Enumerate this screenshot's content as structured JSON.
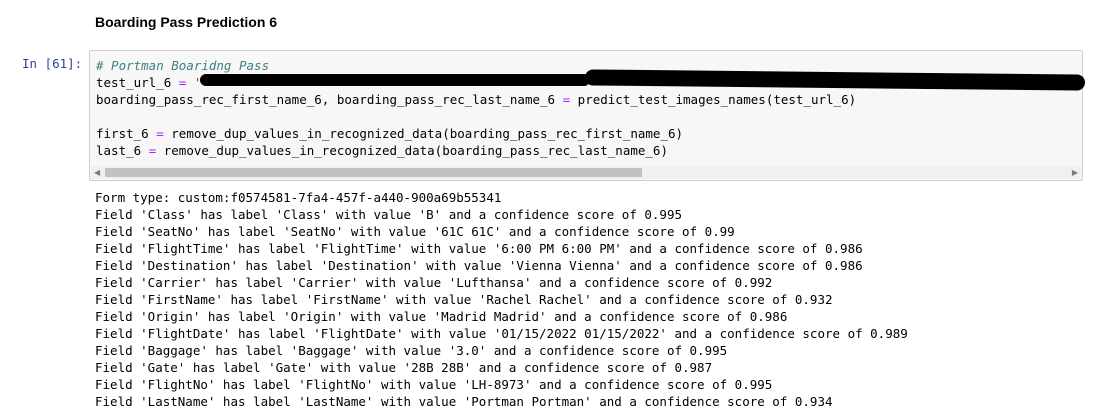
{
  "markdown": {
    "heading": "Boarding Pass Prediction 6"
  },
  "cell": {
    "prompt": "In [61]:",
    "comment": "# Portman Boaridng Pass",
    "line2_var": "test_url_6",
    "line2_eq": "=",
    "line2_quote": "'",
    "line3_lhs": "boarding_pass_rec_first_name_6, boarding_pass_rec_last_name_6",
    "line3_eq": "=",
    "line3_rhs": "predict_test_images_names(test_url_6)",
    "line5_lhs": "first_6",
    "line5_eq": "=",
    "line5_rhs": "remove_dup_values_in_recognized_data(boarding_pass_rec_first_name_6)",
    "line6_lhs": "last_6",
    "line6_eq": "=",
    "line6_rhs": "remove_dup_values_in_recognized_data(boarding_pass_rec_last_name_6)"
  },
  "scrollbar": {
    "left_arrow": "◀",
    "right_arrow": "▶"
  },
  "output": {
    "lines": [
      "Form type: custom:f0574581-7fa4-457f-a440-900a69b55341",
      "Field 'Class' has label 'Class' with value 'B' and a confidence score of 0.995",
      "Field 'SeatNo' has label 'SeatNo' with value '61C 61C' and a confidence score of 0.99",
      "Field 'FlightTime' has label 'FlightTime' with value '6:00 PM 6:00 PM' and a confidence score of 0.986",
      "Field 'Destination' has label 'Destination' with value 'Vienna Vienna' and a confidence score of 0.986",
      "Field 'Carrier' has label 'Carrier' with value 'Lufthansa' and a confidence score of 0.992",
      "Field 'FirstName' has label 'FirstName' with value 'Rachel Rachel' and a confidence score of 0.932",
      "Field 'Origin' has label 'Origin' with value 'Madrid Madrid' and a confidence score of 0.986",
      "Field 'FlightDate' has label 'FlightDate' with value '01/15/2022 01/15/2022' and a confidence score of 0.989",
      "Field 'Baggage' has label 'Baggage' with value '3.0' and a confidence score of 0.995",
      "Field 'Gate' has label 'Gate' with value '28B 28B' and a confidence score of 0.987",
      "Field 'FlightNo' has label 'FlightNo' with value 'LH-8973' and a confidence score of 0.995",
      "Field 'LastName' has label 'LastName' with value 'Portman Portman' and a confidence score of 0.934"
    ]
  },
  "colors": {
    "prompt": "#303f9f",
    "comment": "#408080",
    "operator": "#aa22ff",
    "string": "#ba2121",
    "cell_bg": "#f7f7f7",
    "cell_border": "#cfcfcf"
  }
}
